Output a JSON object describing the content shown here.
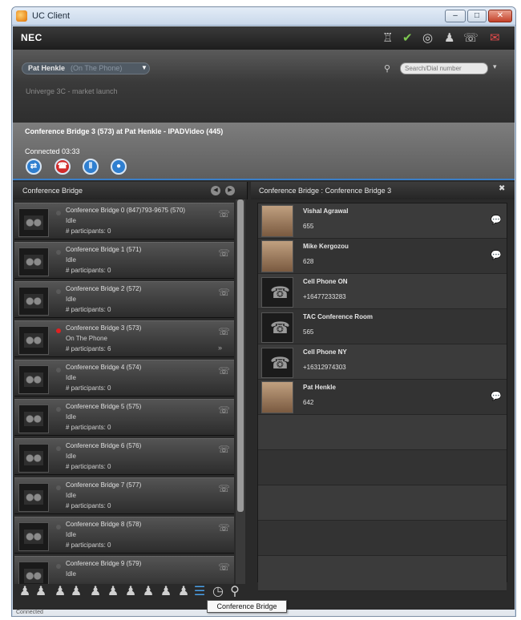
{
  "window": {
    "title": "UC Client",
    "min": "–",
    "max": "□",
    "close": "✕"
  },
  "toolbar": {
    "logo": "NEC"
  },
  "header": {
    "user_name": "Pat Henkle",
    "user_status": "(On The Phone)",
    "dropdown": "▼",
    "status_message": "Univerge 3C - market launch",
    "search_placeholder": "Search/Dial number"
  },
  "call": {
    "title": "Conference Bridge 3 (573) at Pat Henkle - IPADVideo (445)",
    "state": "Connected 03:33"
  },
  "left_panel": {
    "title": "Conference Bridge",
    "bridges": [
      {
        "name": "Conference Bridge 0 (847)793-9675 (570)",
        "status": "Idle",
        "participants": "# participants: 0",
        "active": false
      },
      {
        "name": "Conference Bridge 1 (571)",
        "status": "Idle",
        "participants": "# participants: 0",
        "active": false
      },
      {
        "name": "Conference Bridge 2 (572)",
        "status": "Idle",
        "participants": "# participants: 0",
        "active": false
      },
      {
        "name": "Conference Bridge 3 (573)",
        "status": "On The Phone",
        "participants": "# participants: 6",
        "active": true
      },
      {
        "name": "Conference Bridge 4 (574)",
        "status": "Idle",
        "participants": "# participants: 0",
        "active": false
      },
      {
        "name": "Conference Bridge 5 (575)",
        "status": "Idle",
        "participants": "# participants: 0",
        "active": false
      },
      {
        "name": "Conference Bridge 6 (576)",
        "status": "Idle",
        "participants": "# participants: 0",
        "active": false
      },
      {
        "name": "Conference Bridge 7 (577)",
        "status": "Idle",
        "participants": "# participants: 0",
        "active": false
      },
      {
        "name": "Conference Bridge 8 (578)",
        "status": "Idle",
        "participants": "# participants: 0",
        "active": false
      },
      {
        "name": "Conference Bridge 9 (579)",
        "status": "Idle",
        "participants": "",
        "active": false
      }
    ]
  },
  "right_panel": {
    "title": "Conference Bridge : Conference Bridge 3",
    "participants": [
      {
        "name": "Vishal Agrawal",
        "number": "655",
        "type": "person"
      },
      {
        "name": "Mike Kergozou",
        "number": "628",
        "type": "person"
      },
      {
        "name": "Cell Phone  ON",
        "number": "+16477233283",
        "type": "phone"
      },
      {
        "name": "TAC Conference Room",
        "number": "565",
        "type": "phone"
      },
      {
        "name": "Cell Phone  NY",
        "number": "+16312974303",
        "type": "phone"
      },
      {
        "name": "Pat Henkle",
        "number": "642",
        "type": "person"
      }
    ]
  },
  "statusbar": {
    "text": "Connected"
  },
  "tooltip": {
    "text": "Conference Bridge"
  }
}
